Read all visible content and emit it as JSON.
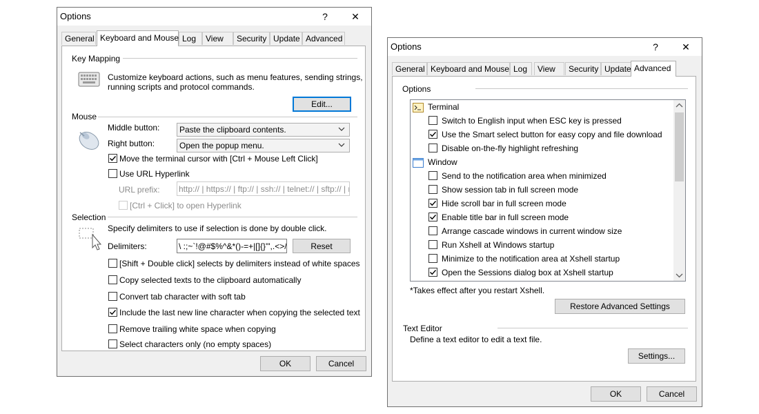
{
  "left_dialog": {
    "title": "Options",
    "help": "?",
    "close": "✕",
    "tabs": [
      "General",
      "Keyboard and Mouse",
      "Log",
      "View",
      "Security",
      "Update",
      "Advanced"
    ],
    "active_tab": "Keyboard and Mouse",
    "key_mapping": {
      "heading": "Key Mapping",
      "desc1": "Customize keyboard actions, such as menu features, sending strings,",
      "desc2": "running scripts and protocol commands.",
      "edit_button": "Edit..."
    },
    "mouse": {
      "heading": "Mouse",
      "middle_label": "Middle button:",
      "middle_value": "Paste the clipboard contents.",
      "right_label": "Right button:",
      "right_value": "Open the popup menu.",
      "move_cursor": "Move the terminal cursor with [Ctrl + Mouse Left Click]",
      "move_cursor_checked": true,
      "url_hyperlink": "Use URL Hyperlink",
      "url_hyperlink_checked": false,
      "url_prefix_label": "URL prefix:",
      "url_prefix_value": "http:// | https:// | ftp:// | ssh:// | telnet:// | sftp:// | rlogin://",
      "ctrl_click": "[Ctrl + Click] to open Hyperlink"
    },
    "selection": {
      "heading": "Selection",
      "desc": "Specify delimiters to use if selection is done by double click.",
      "delimiters_label": "Delimiters:",
      "delimiters_value": "\\ :;~`!@#$%^&*()-=+|[]{}'\",.<>/?",
      "reset_button": "Reset",
      "options": [
        {
          "label": "[Shift + Double click] selects by delimiters instead of white spaces",
          "checked": false
        },
        {
          "label": "Copy selected texts to the clipboard automatically",
          "checked": false
        },
        {
          "label": "Convert tab character with soft tab",
          "checked": false
        },
        {
          "label": "Include the last new line character when copying the selected text",
          "checked": true
        },
        {
          "label": "Remove trailing white space when copying",
          "checked": false
        },
        {
          "label": "Select characters only (no empty spaces)",
          "checked": false
        }
      ]
    },
    "ok": "OK",
    "cancel": "Cancel"
  },
  "right_dialog": {
    "title": "Options",
    "help": "?",
    "close": "✕",
    "tabs": [
      "General",
      "Keyboard and Mouse",
      "Log",
      "View",
      "Security",
      "Update",
      "Advanced"
    ],
    "active_tab": "Advanced",
    "options_heading": "Options",
    "groups": [
      {
        "name": "Terminal",
        "icon": "terminal-icon",
        "items": [
          {
            "label": "Switch to English input when ESC key is pressed",
            "checked": false
          },
          {
            "label": "Use the Smart select button for easy copy and file download",
            "checked": true
          },
          {
            "label": "Disable on-the-fly highlight refreshing",
            "checked": false
          }
        ]
      },
      {
        "name": "Window",
        "icon": "window-icon",
        "items": [
          {
            "label": "Send to the notification area when minimized",
            "checked": false
          },
          {
            "label": "Show session tab in full screen mode",
            "checked": false
          },
          {
            "label": "Hide scroll bar in full screen mode",
            "checked": true
          },
          {
            "label": "Enable title bar in full screen mode",
            "checked": true
          },
          {
            "label": "Arrange cascade windows in current window size",
            "checked": false
          },
          {
            "label": "Run Xshell at Windows startup",
            "checked": false
          },
          {
            "label": "Minimize to the notification area at Xshell startup",
            "checked": false
          },
          {
            "label": "Open the Sessions dialog box at Xshell startup",
            "checked": true
          }
        ]
      }
    ],
    "restart_note": "*Takes effect after you restart Xshell.",
    "restore_button": "Restore Advanced Settings",
    "text_editor_heading": "Text Editor",
    "text_editor_desc": "Define a text editor to edit a text file.",
    "settings_button": "Settings...",
    "ok": "OK",
    "cancel": "Cancel"
  },
  "colors": {
    "dialog_bg": "#f0f0f0",
    "accent": "#0078d7",
    "checkmark": "#000000"
  }
}
